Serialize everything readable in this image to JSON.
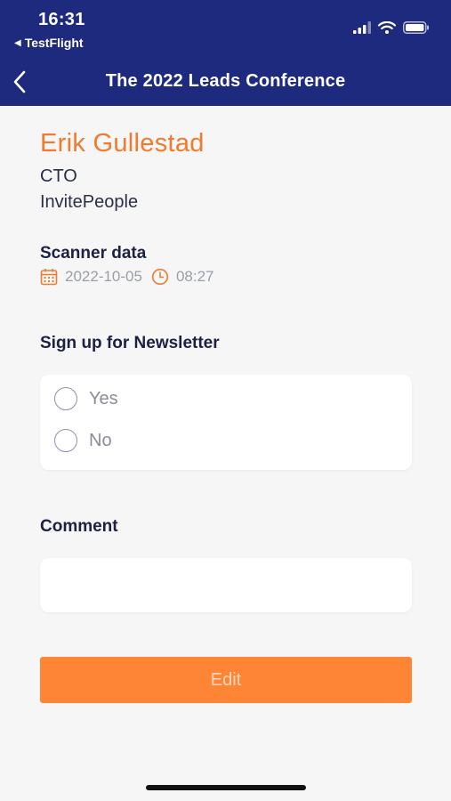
{
  "status_bar": {
    "time": "16:31",
    "back_app": "TestFlight",
    "back_glyph": "◀",
    "icons": [
      "signal-icon",
      "wifi-icon",
      "battery-icon"
    ]
  },
  "nav": {
    "title": "The 2022 Leads Conference",
    "back_icon": "chevron-left-icon"
  },
  "contact": {
    "name": "Erik Gullestad",
    "role": "CTO",
    "company": "InvitePeople"
  },
  "scanner": {
    "title": "Scanner data",
    "date": "2022-10-05",
    "time": "08:27",
    "date_icon": "calendar-icon",
    "time_icon": "clock-icon"
  },
  "newsletter": {
    "title": "Sign up for Newsletter",
    "options": [
      {
        "label": "Yes",
        "selected": false
      },
      {
        "label": "No",
        "selected": false
      }
    ]
  },
  "comment": {
    "title": "Comment",
    "value": "",
    "placeholder": ""
  },
  "edit_label": "Edit",
  "colors": {
    "header_bg": "#1e2a7e",
    "accent_orange": "#f07a2e",
    "button_bg": "#fd8535",
    "page_bg": "#f6f6f7"
  }
}
